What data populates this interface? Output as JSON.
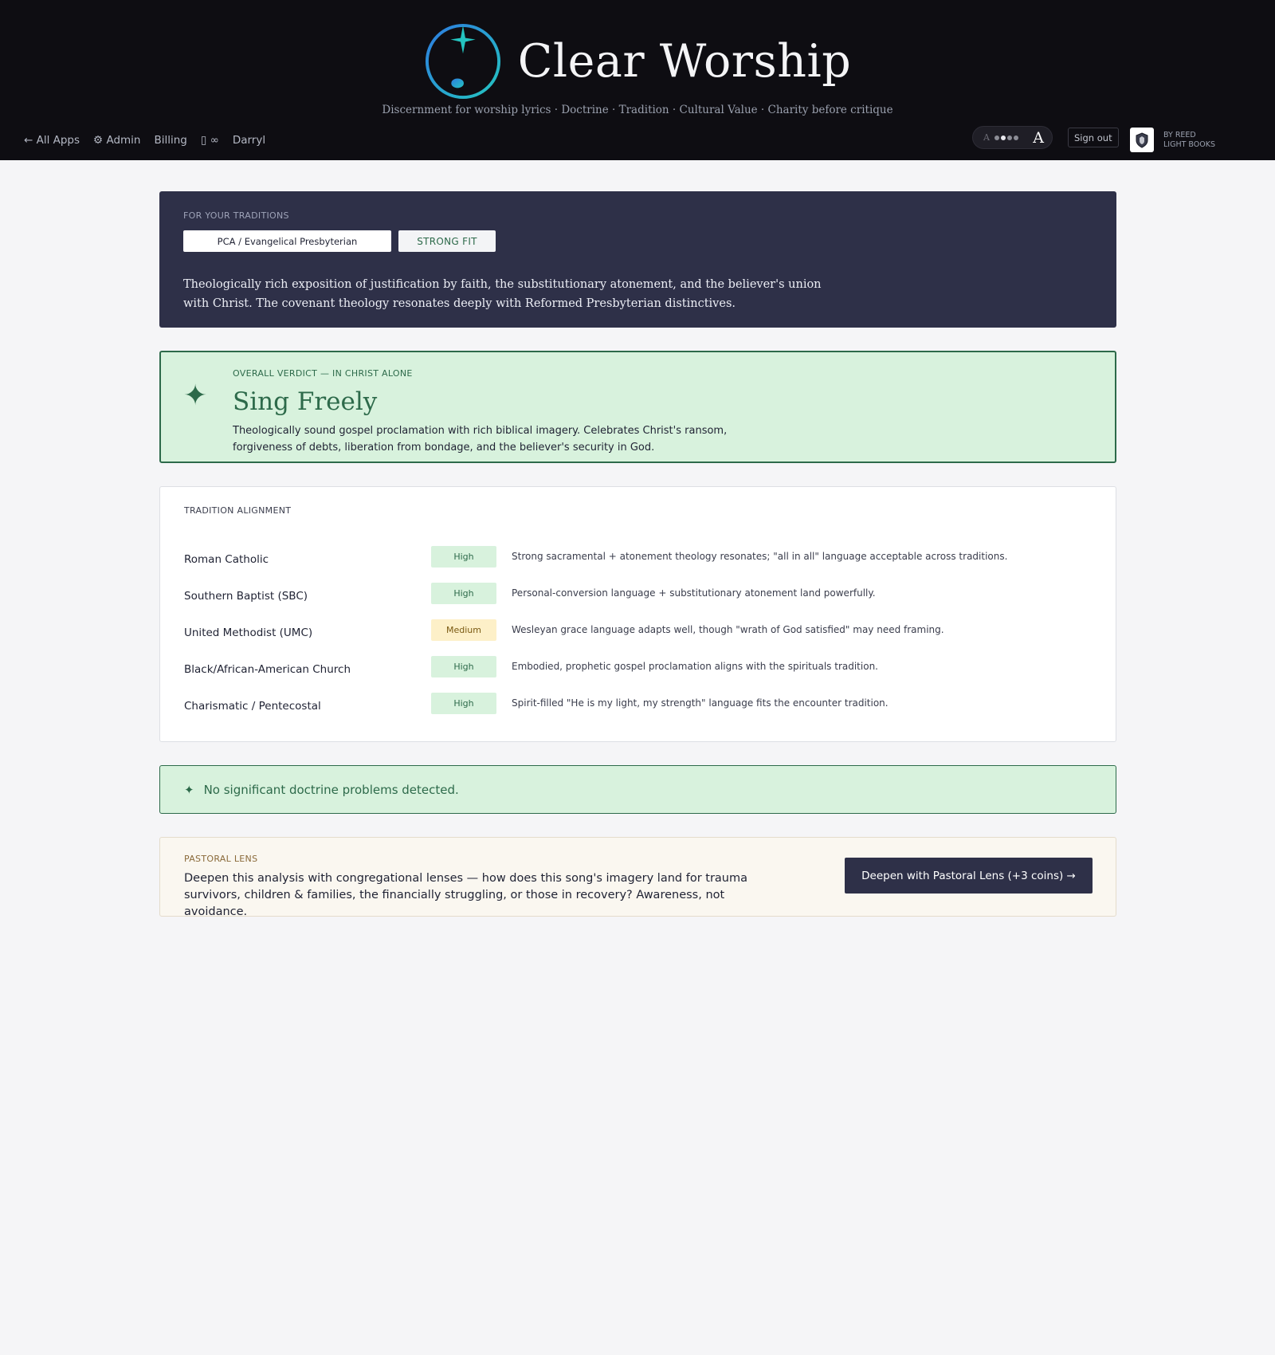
{
  "app": {
    "title": "Clear Worship",
    "tagline": "Discernment for worship lyrics · Doctrine · Tradition · Cultural Value · Charity before critique"
  },
  "nav": {
    "all_apps": "← All Apps",
    "admin": "⚙ Admin",
    "billing": "Billing",
    "coins": "▯ ∞",
    "user": "Darryl"
  },
  "font_control": {
    "small": "A",
    "big": "A",
    "level": 2,
    "levels": 4
  },
  "signout_label": "Sign out",
  "by_reed": {
    "line1": "BY REED",
    "line2": "LIGHT BOOKS"
  },
  "traditions": {
    "label": "FOR YOUR TRADITIONS",
    "selected": "PCA / Evangelical Presbyterian",
    "fit": "STRONG FIT",
    "description": "Theologically rich exposition of justification by faith, the substitutionary atonement, and the believer's union with Christ. The covenant theology resonates deeply with Reformed Presbyterian distinctives."
  },
  "verdict": {
    "label": "OVERALL VERDICT — IN CHRIST ALONE",
    "title": "Sing Freely",
    "description": "Theologically sound gospel proclamation with rich biblical imagery. Celebrates Christ's ransom, forgiveness of debts, liberation from bondage, and the believer's security in God."
  },
  "alignment": {
    "label": "TRADITION ALIGNMENT",
    "rows": [
      {
        "name": "Roman Catholic",
        "level": "High",
        "note": "Strong sacramental + atonement theology resonates; \"all in all\" language acceptable across traditions."
      },
      {
        "name": "Southern Baptist (SBC)",
        "level": "High",
        "note": "Personal-conversion language + substitutionary atonement land powerfully."
      },
      {
        "name": "United Methodist (UMC)",
        "level": "Medium",
        "note": "Wesleyan grace language adapts well, though \"wrath of God satisfied\" may need framing."
      },
      {
        "name": "Black/African-American Church",
        "level": "High",
        "note": "Embodied, prophetic gospel proclamation aligns with the spirituals tradition."
      },
      {
        "name": "Charismatic / Pentecostal",
        "level": "High",
        "note": "Spirit-filled \"He is my light, my strength\" language fits the encounter tradition."
      }
    ]
  },
  "problems": {
    "icon": "✦",
    "text": "No significant doctrine problems detected."
  },
  "pastoral": {
    "label": "PASTORAL LENS",
    "description": "Deepen this analysis with congregational lenses — how does this song's imagery land for trauma survivors, children & families, the financially struggling, or those in recovery? Awareness, not avoidance.",
    "button": "Deepen with Pastoral Lens (+3 coins) →"
  },
  "colors": {
    "header_bg": "#0e0d12",
    "navy": "#2e3048",
    "green": "#2d6a4a",
    "green_bg": "#d8f2dd",
    "medium_bg": "#fdf0c8"
  }
}
